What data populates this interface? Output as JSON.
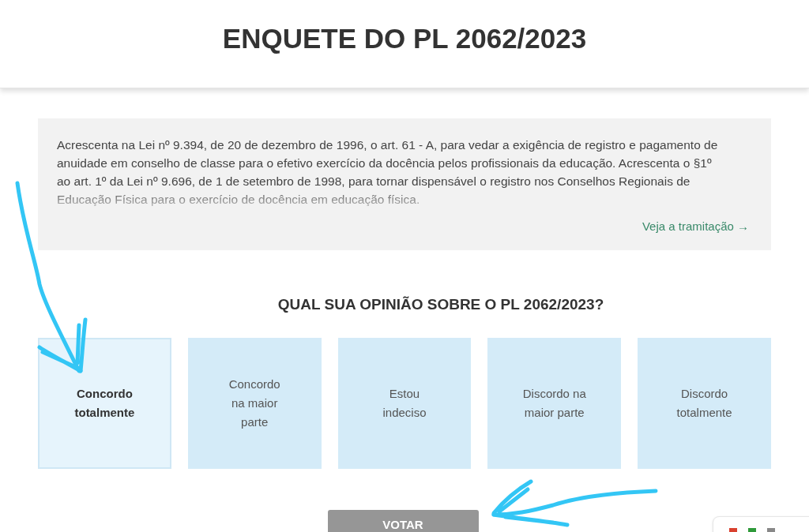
{
  "title": "ENQUETE DO PL 2062/2023",
  "summary": {
    "text": "Acrescenta na Lei nº 9.394, de 20 de dezembro de 1996, o art. 61 - A, para vedar a exigência de registro e pagamento de anuidade em conselho de classe para o efetivo exercício da docência pelos profissionais da educação. Acrescenta o §1º ao art. 1º da Lei nº 9.696, de 1 de setembro de 1998, para tornar dispensável o registro nos Conselhos Regionais de Educação Física para o exercício de docência em educação física.",
    "link": "Veja a tramitação →"
  },
  "question": "QUAL SUA OPINIÃO SOBRE O PL 2062/2023?",
  "options": [
    {
      "label": "Concordo totalmente",
      "selected": true
    },
    {
      "label": "Concordo na maior parte",
      "selected": false
    },
    {
      "label": "Estou indeciso",
      "selected": false
    },
    {
      "label": "Discordo na maior parte",
      "selected": false
    },
    {
      "label": "Discordo totalmente",
      "selected": false
    }
  ],
  "vote_button": {
    "label": "VOTAR",
    "disabled": true
  }
}
